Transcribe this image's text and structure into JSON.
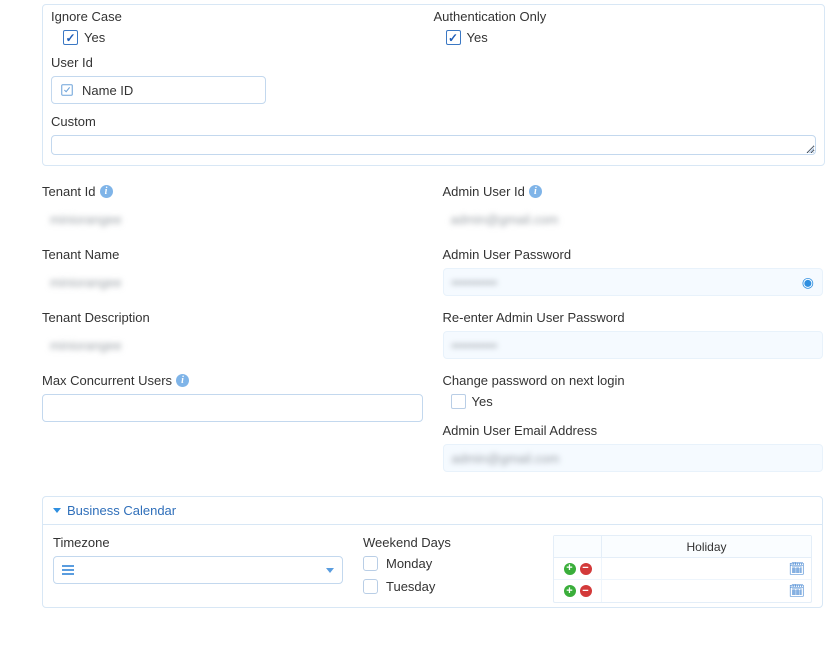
{
  "topPanel": {
    "ignoreCase": {
      "label": "Ignore Case",
      "yes": "Yes",
      "checked": true
    },
    "authOnly": {
      "label": "Authentication Only",
      "yes": "Yes",
      "checked": true
    },
    "userId": {
      "label": "User Id",
      "value": "Name ID"
    },
    "custom": {
      "label": "Custom"
    }
  },
  "tenant": {
    "id": {
      "label": "Tenant Id"
    },
    "name": {
      "label": "Tenant Name"
    },
    "desc": {
      "label": "Tenant Description"
    },
    "maxUsers": {
      "label": "Max Concurrent Users"
    }
  },
  "admin": {
    "userId": {
      "label": "Admin User Id"
    },
    "password": {
      "label": "Admin User Password"
    },
    "repassword": {
      "label": "Re-enter Admin User Password"
    },
    "changePw": {
      "label": "Change password on next login",
      "yes": "Yes",
      "checked": false
    },
    "email": {
      "label": "Admin User Email Address"
    }
  },
  "calendar": {
    "title": "Business Calendar",
    "timezone": {
      "label": "Timezone"
    },
    "weekendDays": {
      "label": "Weekend Days",
      "days": {
        "mon": "Monday",
        "tue": "Tuesday"
      }
    },
    "holiday": {
      "label": "Holiday"
    }
  }
}
